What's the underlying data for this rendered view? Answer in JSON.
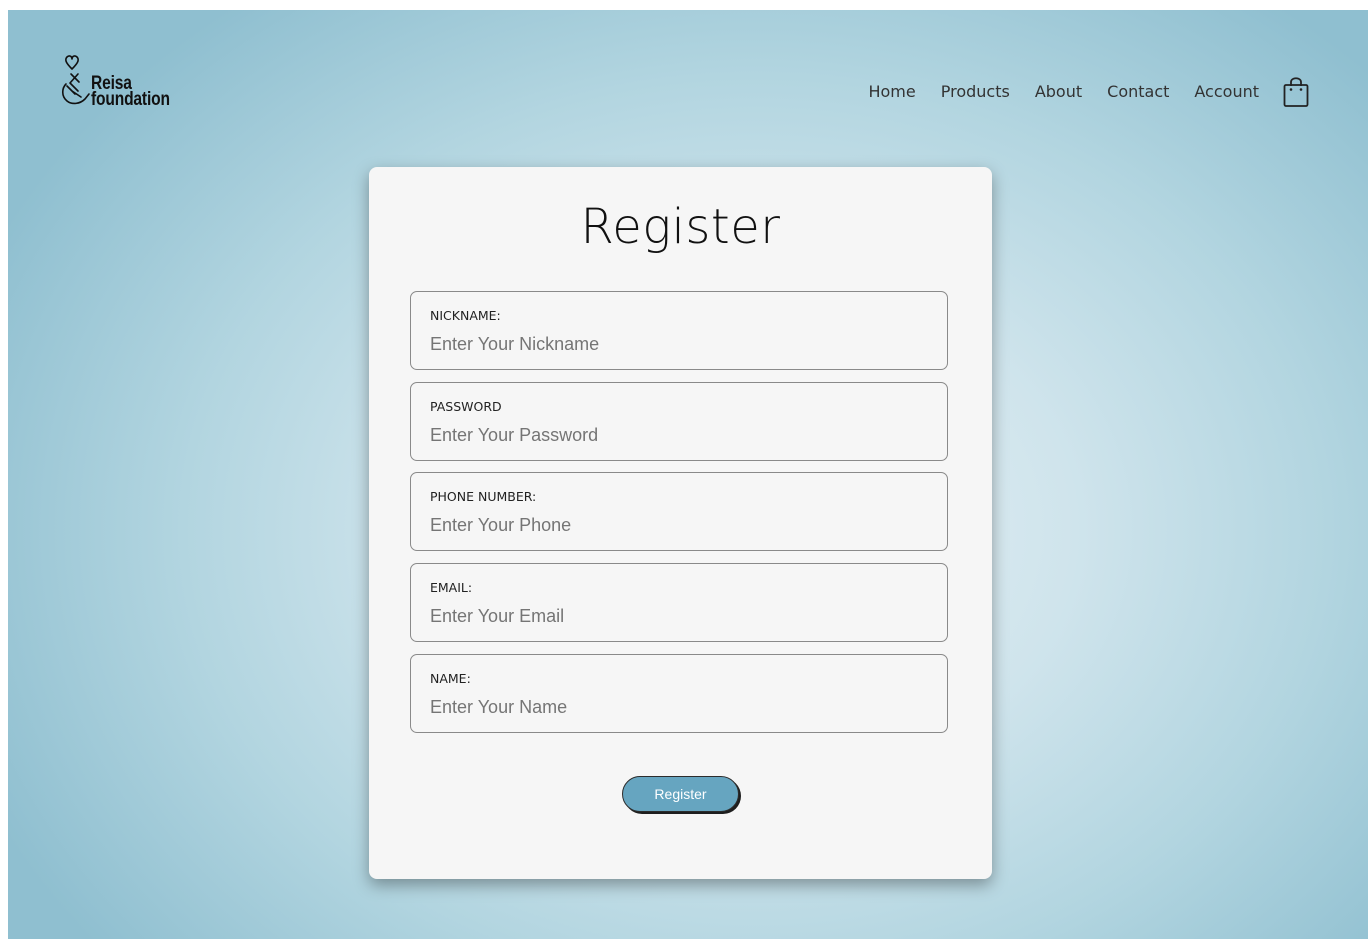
{
  "brand": {
    "line1": "Reisa",
    "line2": "foundation",
    "logo_icon": "heart-hand-icon"
  },
  "nav": {
    "items": [
      "Home",
      "Products",
      "About",
      "Contact",
      "Account"
    ],
    "cart_icon": "shopping-bag-icon"
  },
  "form": {
    "title": "Register",
    "fields": [
      {
        "label": "NICKNAME:",
        "placeholder": "Enter Your Nickname"
      },
      {
        "label": "PASSWORD",
        "placeholder": "Enter Your Password"
      },
      {
        "label": "PHONE NUMBER:",
        "placeholder": "Enter Your Phone"
      },
      {
        "label": "EMAIL:",
        "placeholder": "Enter Your Email"
      },
      {
        "label": "NAME:",
        "placeholder": "Enter Your Name"
      }
    ],
    "submit_label": "Register"
  },
  "colors": {
    "button_bg": "#66a5c0",
    "card_bg": "#f6f6f6",
    "background": "#b2d5e0"
  }
}
